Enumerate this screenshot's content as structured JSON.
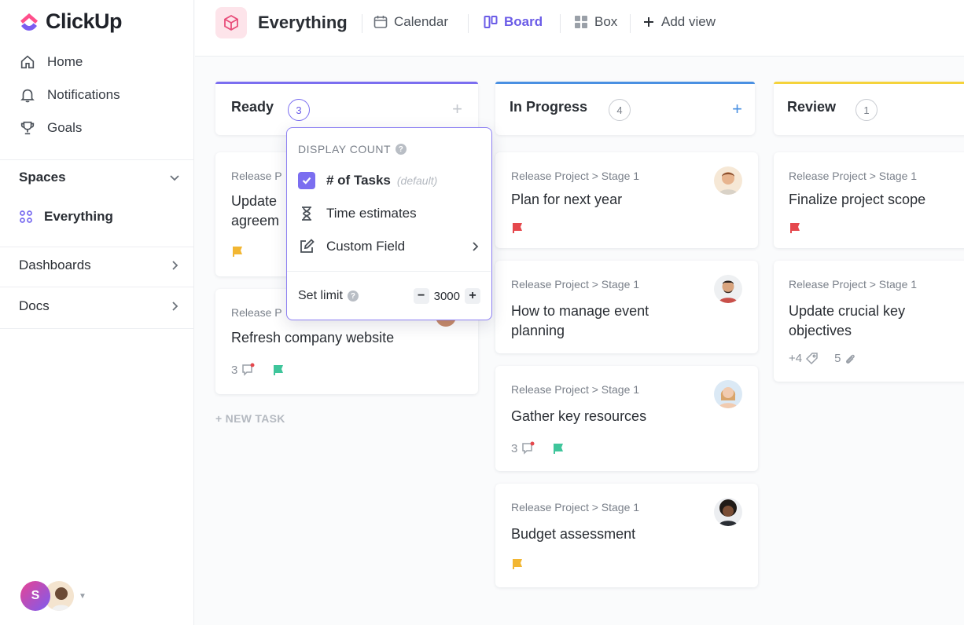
{
  "brand": {
    "name": "ClickUp"
  },
  "sidebar": {
    "nav": [
      {
        "label": "Home",
        "icon": "home-icon"
      },
      {
        "label": "Notifications",
        "icon": "bell-icon"
      },
      {
        "label": "Goals",
        "icon": "trophy-icon"
      }
    ],
    "spaces_label": "Spaces",
    "space_item": "Everything",
    "dashboards_label": "Dashboards",
    "docs_label": "Docs",
    "user_initial": "S"
  },
  "topbar": {
    "title": "Everything",
    "views": [
      {
        "label": "Calendar",
        "icon": "calendar-icon"
      },
      {
        "label": "Board",
        "icon": "board-icon",
        "active": true
      },
      {
        "label": "Box",
        "icon": "box-icon"
      },
      {
        "label": "Add view",
        "icon": "plus-icon"
      }
    ]
  },
  "columns": [
    {
      "name": "Ready",
      "count": "3",
      "color": "#7b6ef0"
    },
    {
      "name": "In Progress",
      "count": "4",
      "color": "#4a90e2"
    },
    {
      "name": "Review",
      "count": "1",
      "color": "#f5d33b"
    }
  ],
  "cards": {
    "ready": [
      {
        "crumb": "Release P",
        "title_line1": "Update",
        "title_line2": "agreem",
        "flag": "#f2b632"
      },
      {
        "crumb": "Release P",
        "title": "Refresh company website",
        "comments": "3",
        "flag": "#3fc59b"
      }
    ],
    "progress": [
      {
        "crumb": "Release Project > Stage 1",
        "title": "Plan for next year",
        "flag": "#e5484d"
      },
      {
        "crumb": "Release Project > Stage 1",
        "title_line1": "How to manage event",
        "title_line2": "planning"
      },
      {
        "crumb": "Release Project > Stage 1",
        "title": "Gather key resources",
        "comments": "3",
        "flag": "#3fc59b"
      },
      {
        "crumb": "Release Project > Stage 1",
        "title": "Budget assessment",
        "flag": "#f2b632"
      }
    ],
    "review": [
      {
        "crumb": "Release Project > Stage 1",
        "title": "Finalize project scope",
        "flag": "#e5484d"
      },
      {
        "crumb": "Release Project > Stage 1",
        "title_line1": "Update crucial key",
        "title_line2": "objectives",
        "tags": "+4",
        "attachments": "5"
      }
    ]
  },
  "new_task_label": "+ NEW TASK",
  "popover": {
    "heading": "DISPLAY COUNT",
    "options": [
      {
        "label": "# of Tasks",
        "note": "(default)",
        "checked": true
      },
      {
        "label": "Time estimates"
      },
      {
        "label": "Custom Field"
      }
    ],
    "limit_label": "Set limit",
    "limit_value": "3000"
  }
}
